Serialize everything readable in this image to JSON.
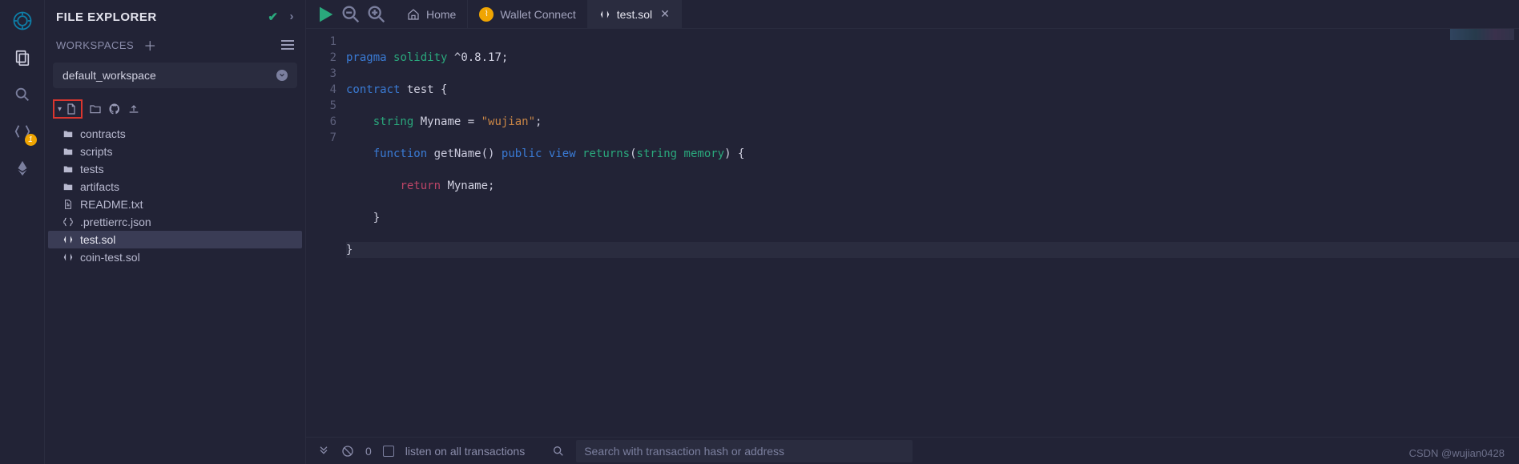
{
  "left_rail": {
    "badge_value": "1"
  },
  "explorer": {
    "title": "FILE EXPLORER",
    "workspaces_label": "WORKSPACES",
    "selected_workspace": "default_workspace"
  },
  "tree": [
    {
      "icon": "folder",
      "name": "contracts"
    },
    {
      "icon": "folder",
      "name": "scripts"
    },
    {
      "icon": "folder",
      "name": "tests"
    },
    {
      "icon": "folder",
      "name": "artifacts"
    },
    {
      "icon": "file",
      "name": "README.txt"
    },
    {
      "icon": "braces",
      "name": ".prettierrc.json"
    },
    {
      "icon": "sol",
      "name": "test.sol",
      "selected": true
    },
    {
      "icon": "sol",
      "name": "coin-test.sol"
    }
  ],
  "tabs": {
    "home": "Home",
    "wallet": "Wallet Connect",
    "active_file": "test.sol"
  },
  "code": {
    "lines": [
      "1",
      "2",
      "3",
      "4",
      "5",
      "6",
      "7"
    ],
    "l1": {
      "a": "pragma",
      "b": "solidity",
      "c": "^0.8.17;"
    },
    "l2": {
      "a": "contract",
      "b": "test {"
    },
    "l3": {
      "a": "string",
      "b": "Myname = ",
      "c": "\"wujian\"",
      "d": ";"
    },
    "l4": {
      "a": "function",
      "b": "getName()",
      "c": "public",
      "d": "view",
      "e": "returns",
      "f": "(",
      "g": "string",
      "h": "memory",
      "i": ") {"
    },
    "l5": {
      "a": "return",
      "b": "Myname;"
    },
    "l6": "}",
    "l7": "}"
  },
  "statusbar": {
    "zero": "0",
    "listen": "listen on all transactions",
    "search_placeholder": "Search with transaction hash or address"
  },
  "watermark": "CSDN @wujian0428"
}
